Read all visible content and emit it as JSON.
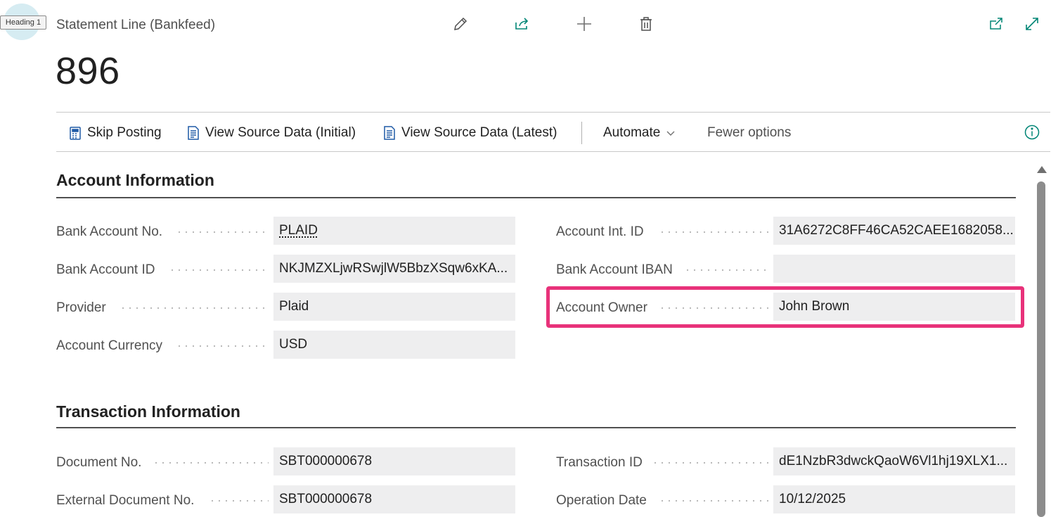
{
  "overlay": {
    "heading_badge": "Heading 1"
  },
  "page": {
    "caption": "Statement Line (Bankfeed)",
    "title": "896"
  },
  "toolbar": {
    "top_icons": [
      "edit-icon",
      "share-icon",
      "add-icon",
      "delete-icon",
      "open-new-window-icon",
      "expand-icon"
    ]
  },
  "actions": {
    "skip_posting": "Skip Posting",
    "view_initial": "View Source Data (Initial)",
    "view_latest": "View Source Data (Latest)",
    "automate": "Automate",
    "fewer_options": "Fewer options"
  },
  "sections": {
    "account": {
      "title": "Account Information",
      "left": [
        {
          "label": "Bank Account No.",
          "value": "PLAID"
        },
        {
          "label": "Bank Account ID",
          "value": "NKJMZXLjwRSwjlW5BbzXSqw6xKA..."
        },
        {
          "label": "Provider",
          "value": "Plaid"
        },
        {
          "label": "Account Currency",
          "value": "USD"
        }
      ],
      "right": [
        {
          "label": "Account Int. ID",
          "value": "31A6272C8FF46CA52CAEE1682058..."
        },
        {
          "label": "Bank Account IBAN",
          "value": ""
        },
        {
          "label": "Account Owner",
          "value": "John Brown"
        }
      ]
    },
    "transaction": {
      "title": "Transaction Information",
      "left": [
        {
          "label": "Document No.",
          "value": "SBT000000678"
        },
        {
          "label": "External Document No.",
          "value": "SBT000000678"
        }
      ],
      "right": [
        {
          "label": "Transaction ID",
          "value": "dE1NzbR3dwckQaoW6Vl1hj19XLX1..."
        },
        {
          "label": "Operation Date",
          "value": "10/12/2025"
        }
      ]
    }
  },
  "colors": {
    "highlight": "#e8327a",
    "accent": "#008575",
    "field_bg": "#eeeeef"
  }
}
